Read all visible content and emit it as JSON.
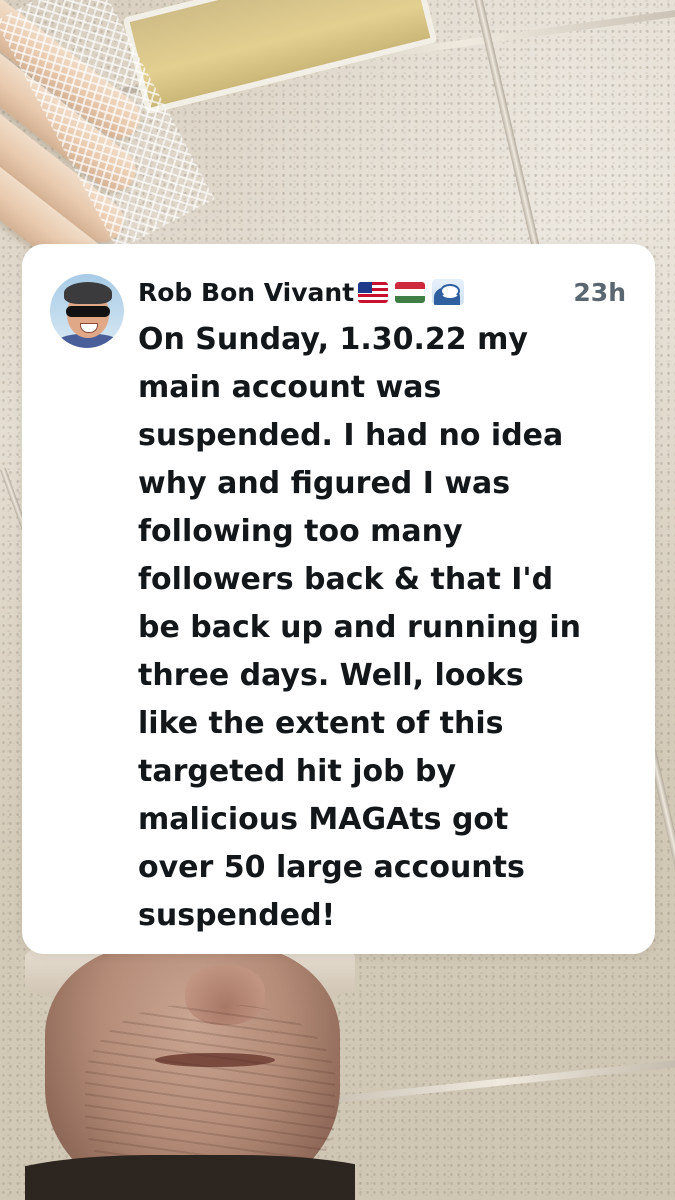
{
  "tweet": {
    "author_name": "Rob Bon Vivant",
    "name_emojis": [
      "us-flag-icon",
      "hungary-flag-icon",
      "wave-icon"
    ],
    "timestamp": "23h",
    "text_lines": [
      "On Sunday, 1.30.22 my",
      "main account was",
      "suspended. I had no idea",
      "why and figured I was",
      "following too many",
      "followers back & that I'd",
      "be back up and running in",
      "three days. Well, looks",
      "like the extent of this",
      "targeted hit job by",
      "malicious MAGAts got",
      "over 50 large accounts",
      "suspended!"
    ]
  }
}
